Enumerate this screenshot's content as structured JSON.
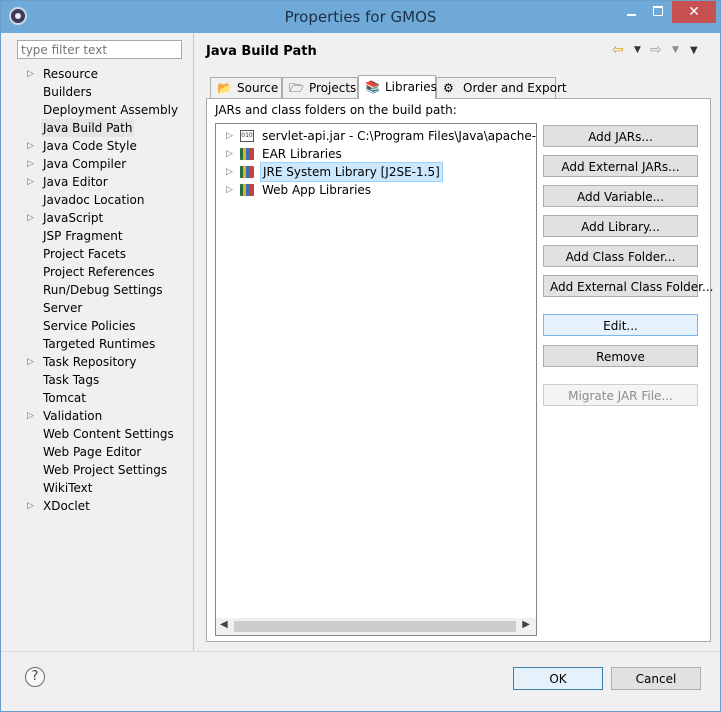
{
  "window": {
    "title": "Properties for GMOS",
    "close_glyph": "✕"
  },
  "sidebar": {
    "filter_placeholder": "type filter text",
    "items": [
      {
        "label": "Resource",
        "expandable": true
      },
      {
        "label": "Builders",
        "expandable": false
      },
      {
        "label": "Deployment Assembly",
        "expandable": false
      },
      {
        "label": "Java Build Path",
        "expandable": false,
        "selected": true
      },
      {
        "label": "Java Code Style",
        "expandable": true
      },
      {
        "label": "Java Compiler",
        "expandable": true
      },
      {
        "label": "Java Editor",
        "expandable": true
      },
      {
        "label": "Javadoc Location",
        "expandable": false
      },
      {
        "label": "JavaScript",
        "expandable": true
      },
      {
        "label": "JSP Fragment",
        "expandable": false
      },
      {
        "label": "Project Facets",
        "expandable": false
      },
      {
        "label": "Project References",
        "expandable": false
      },
      {
        "label": "Run/Debug Settings",
        "expandable": false
      },
      {
        "label": "Server",
        "expandable": false
      },
      {
        "label": "Service Policies",
        "expandable": false
      },
      {
        "label": "Targeted Runtimes",
        "expandable": false
      },
      {
        "label": "Task Repository",
        "expandable": true
      },
      {
        "label": "Task Tags",
        "expandable": false
      },
      {
        "label": "Tomcat",
        "expandable": false
      },
      {
        "label": "Validation",
        "expandable": true
      },
      {
        "label": "Web Content Settings",
        "expandable": false
      },
      {
        "label": "Web Page Editor",
        "expandable": false
      },
      {
        "label": "Web Project Settings",
        "expandable": false
      },
      {
        "label": "WikiText",
        "expandable": false
      },
      {
        "label": "XDoclet",
        "expandable": true
      }
    ]
  },
  "main": {
    "title": "Java Build Path",
    "tabs": [
      {
        "label": "Source",
        "icon": "source-folder-icon"
      },
      {
        "label": "Projects",
        "icon": "projects-folder-icon"
      },
      {
        "label": "Libraries",
        "icon": "libraries-icon",
        "active": true
      },
      {
        "label": "Order and Export",
        "icon": "order-export-icon"
      }
    ],
    "list_label": "JARs and class folders on the build path:",
    "libraries": [
      {
        "label": "servlet-api.jar - C:\\Program Files\\Java\\apache-tor",
        "icon": "jar-icon"
      },
      {
        "label": "EAR Libraries",
        "icon": "library-icon"
      },
      {
        "label": "JRE System Library [J2SE-1.5]",
        "icon": "library-icon",
        "selected": true
      },
      {
        "label": "Web App Libraries",
        "icon": "library-icon"
      }
    ],
    "buttons": {
      "add_jars": "Add JARs...",
      "add_external_jars": "Add External JARs...",
      "add_variable": "Add Variable...",
      "add_library": "Add Library...",
      "add_class_folder": "Add Class Folder...",
      "add_external_class_folder": "Add External Class Folder...",
      "edit": "Edit...",
      "remove": "Remove",
      "migrate_jar": "Migrate JAR File..."
    }
  },
  "footer": {
    "help_glyph": "?",
    "ok": "OK",
    "cancel": "Cancel"
  }
}
